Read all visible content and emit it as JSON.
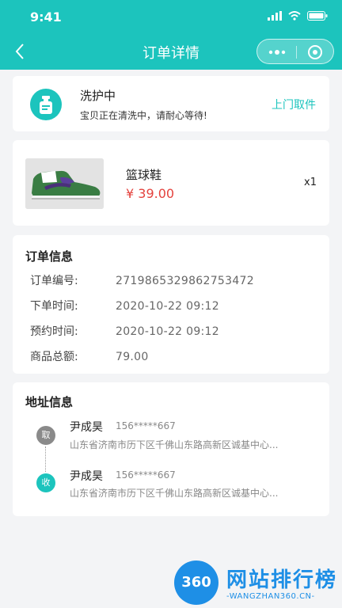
{
  "status_bar": {
    "time": "9:41"
  },
  "nav": {
    "title": "订单详情"
  },
  "order_status": {
    "title": "洗护中",
    "description": "宝贝正在清洗中，请耐心等待!",
    "action_label": "上门取件"
  },
  "product": {
    "name": "篮球鞋",
    "price": "¥ 39.00",
    "quantity": "x1"
  },
  "order_info": {
    "title": "订单信息",
    "rows": [
      {
        "label": "订单编号:",
        "value": "2719865329862753472"
      },
      {
        "label": "下单时间:",
        "value": "2020-10-22 09:12"
      },
      {
        "label": "预约时间:",
        "value": "2020-10-22 09:12"
      },
      {
        "label": "商品总额:",
        "value": "79.00"
      }
    ]
  },
  "address_info": {
    "title": "地址信息",
    "pickup": {
      "badge": "取",
      "name": "尹成昊",
      "phone": "156*****667",
      "address": "山东省济南市历下区千佛山东路高新区诚基中心..."
    },
    "receive": {
      "badge": "收",
      "name": "尹成昊",
      "phone": "156*****667",
      "address": "山东省济南市历下区千佛山东路高新区诚基中心..."
    }
  },
  "watermark": {
    "logo_text": "360",
    "title": "网站排行榜",
    "subtitle": "-WANGZHAN360.CN-"
  },
  "colors": {
    "primary": "#1cc4bd",
    "price": "#e4423d",
    "watermark": "#1e8fe6"
  }
}
